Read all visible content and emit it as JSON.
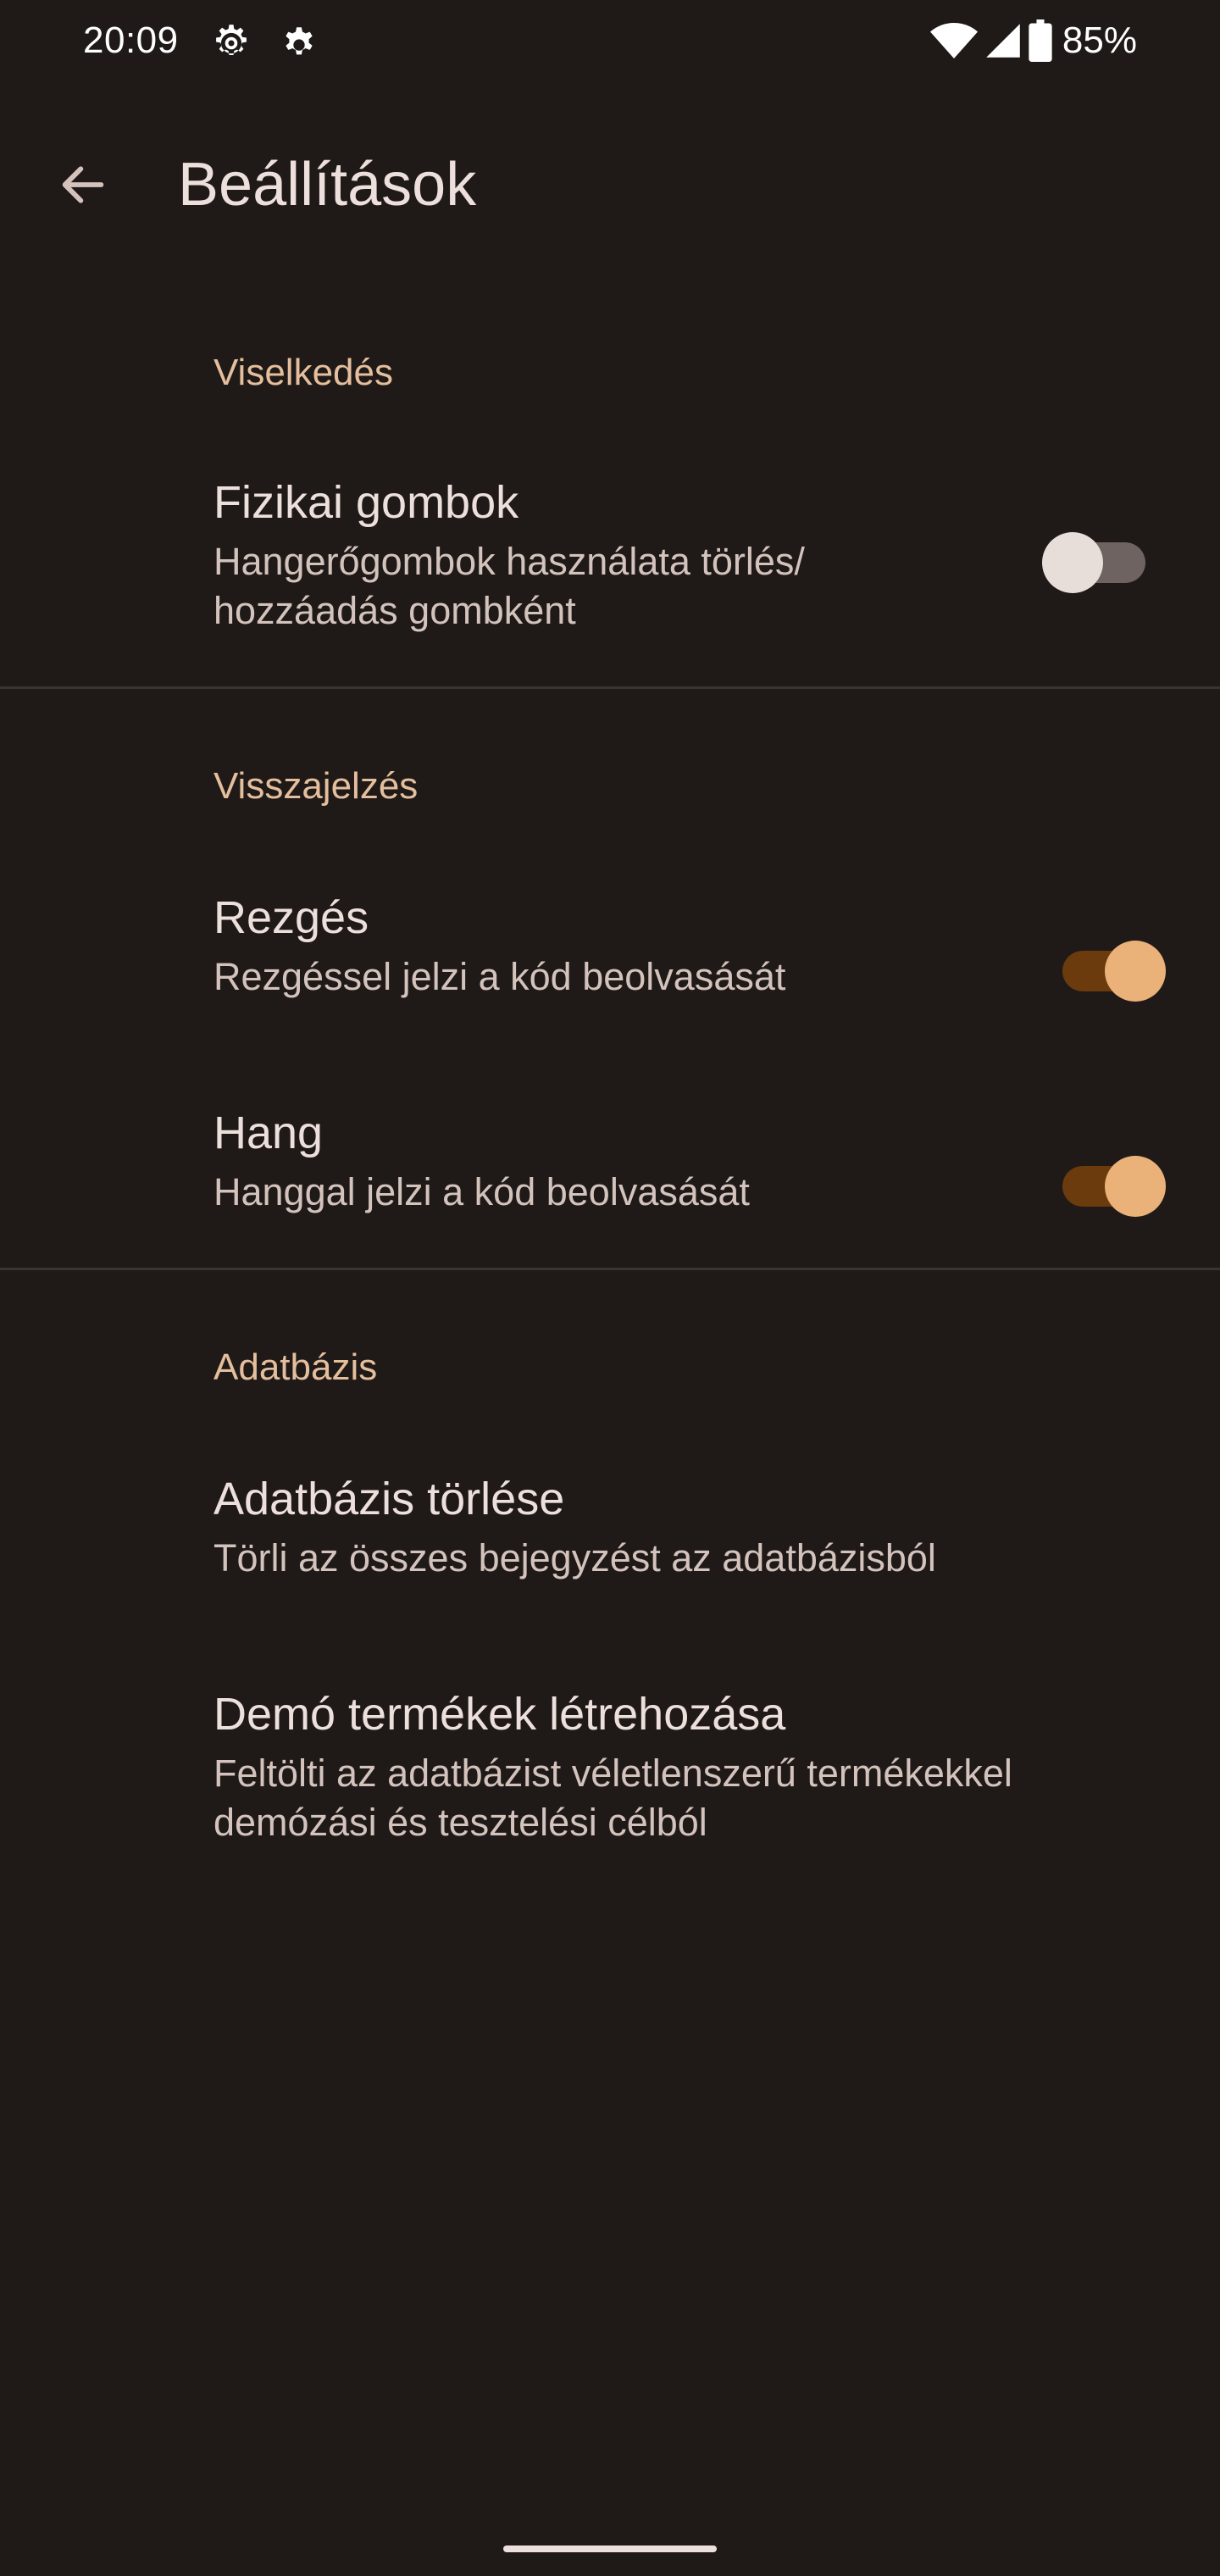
{
  "status_bar": {
    "time": "20:09",
    "battery_percent": "85%",
    "icons": [
      "gear-icon",
      "settings-icon",
      "wifi-icon",
      "cell-signal-icon",
      "battery-icon"
    ]
  },
  "app_bar": {
    "title": "Beállítások",
    "back_icon": "arrow-back-icon"
  },
  "sections": {
    "behavior": {
      "header": "Viselkedés",
      "physical_buttons": {
        "title": "Fizikai gombok",
        "summary_line1": "Hangerőgombok használata törlés/",
        "summary_line2": "hozzáadás gombként",
        "enabled": false
      }
    },
    "feedback": {
      "header": "Visszajelzés",
      "vibration": {
        "title": "Rezgés",
        "summary": "Rezgéssel jelzi a kód beolvasását",
        "enabled": true
      },
      "sound": {
        "title": "Hang",
        "summary": "Hanggal jelzi a kód beolvasását",
        "enabled": true
      }
    },
    "database": {
      "header": "Adatbázis",
      "clear_database": {
        "title": "Adatbázis törlése",
        "summary": "Törli az összes bejegyzést az adatbázisból"
      },
      "demo_products": {
        "title": "Demó termékek létrehozása",
        "summary_line1": "Feltölti az adatbázist véletlenszerű termékekkel",
        "summary_line2": "demózási és tesztelési célból"
      }
    }
  },
  "colors": {
    "background": "#1f1a18",
    "accent": "#e5bf9d",
    "switch_on_thumb": "#eab179",
    "switch_on_track": "#6b3b0d",
    "text_primary": "#ede0dc",
    "text_secondary": "#d3c3bc"
  }
}
